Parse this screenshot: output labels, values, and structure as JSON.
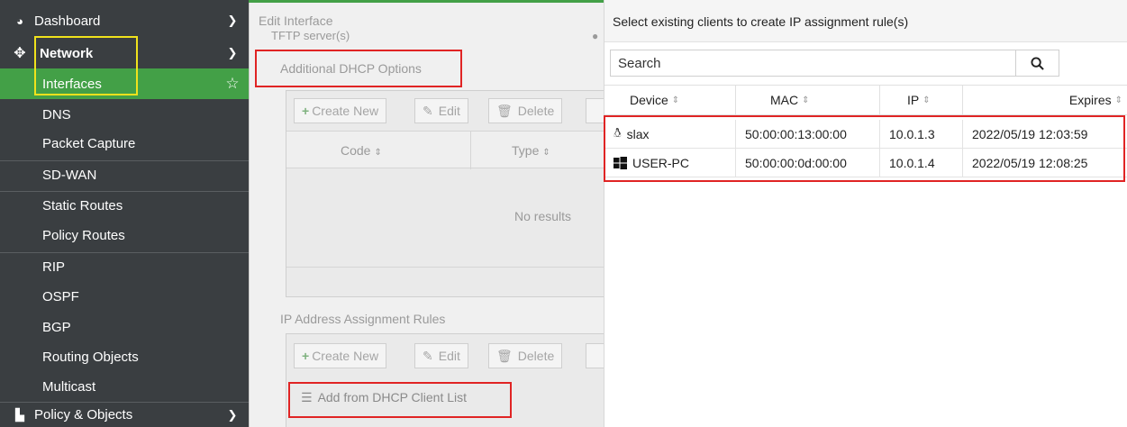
{
  "sidebar": {
    "items": [
      {
        "label": "Dashboard",
        "icon": "dashboard-icon",
        "chevron": ">"
      },
      {
        "label": "Network",
        "icon": "network-move-icon",
        "chevron": "v"
      },
      {
        "label": "Interfaces",
        "star": "☆"
      },
      {
        "label": "DNS"
      },
      {
        "label": "Packet Capture"
      },
      {
        "label": "SD-WAN"
      },
      {
        "label": "Static Routes"
      },
      {
        "label": "Policy Routes"
      },
      {
        "label": "RIP"
      },
      {
        "label": "OSPF"
      },
      {
        "label": "BGP"
      },
      {
        "label": "Routing Objects"
      },
      {
        "label": "Multicast"
      },
      {
        "label": "Policy & Objects",
        "icon": "policy-icon",
        "chevron": ">"
      }
    ]
  },
  "edit_panel": {
    "title": "Edit Interface",
    "tftp_label": "TFTP server(s)",
    "dhcp_options_title": "Additional DHCP Options",
    "create_new": "Create New",
    "edit": "Edit",
    "delete": "Delete",
    "col_code": "Code",
    "col_type": "Type",
    "no_results": "No results",
    "ip_rules_title": "IP Address Assignment Rules",
    "add_from_dhcp": "Add from DHCP Client List"
  },
  "dialog": {
    "title": "Select existing clients to create IP assignment rule(s)",
    "search_placeholder": "Search",
    "columns": [
      "Device",
      "MAC",
      "IP",
      "Expires"
    ],
    "rows": [
      {
        "device": "slax",
        "os_icon": "linux-icon",
        "mac": "50:00:00:13:00:00",
        "ip": "10.0.1.3",
        "expires": "2022/05/19 12:03:59"
      },
      {
        "device": "USER-PC",
        "os_icon": "windows-icon",
        "mac": "50:00:00:0d:00:00",
        "ip": "10.0.1.4",
        "expires": "2022/05/19 12:08:25"
      }
    ]
  },
  "colors": {
    "accent_green": "#43a047",
    "highlight_red": "#e02424",
    "highlight_yellow": "#f0e21c"
  }
}
